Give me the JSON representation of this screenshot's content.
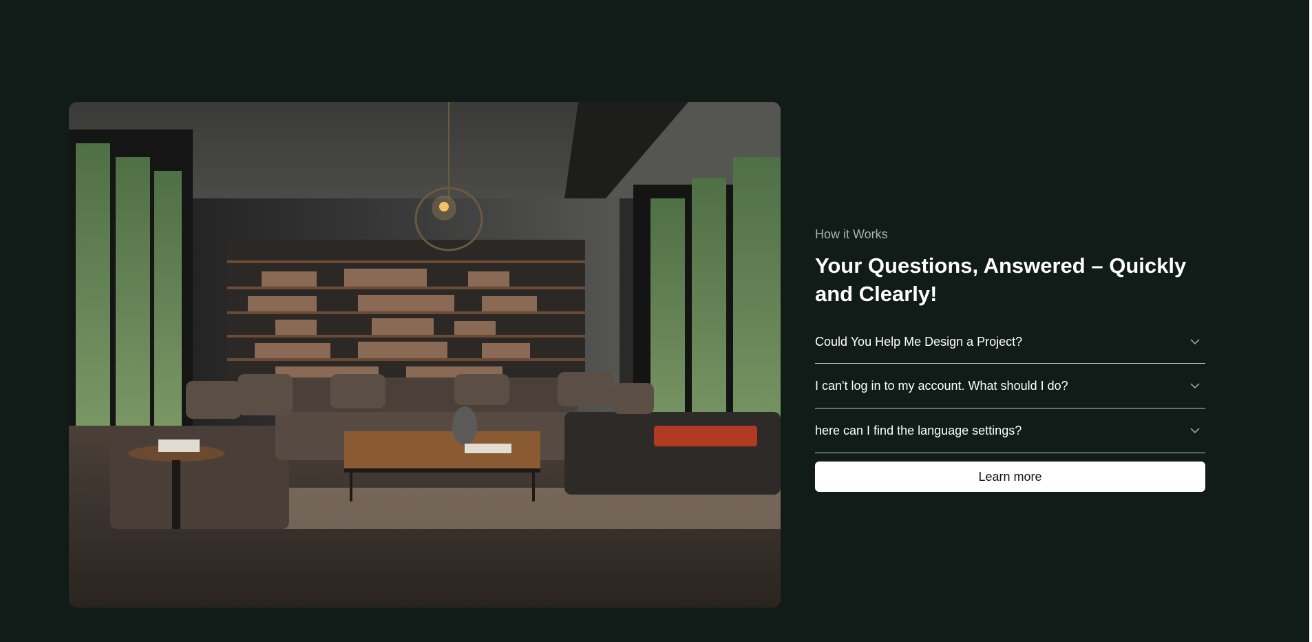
{
  "section": {
    "eyebrow": "How it Works",
    "title": "Your Questions, Answered – Quickly and Clearly!"
  },
  "faq": {
    "items": [
      {
        "question": "Could You Help Me Design a Project?",
        "icon": "chevron-down-icon"
      },
      {
        "question": "I can't log in to my account. What should I do?",
        "icon": "chevron-down-icon"
      },
      {
        "question": "here can I find the language settings?",
        "icon": "chevron-down-icon"
      }
    ],
    "cta_label": "Learn more"
  },
  "colors": {
    "background": "#111b18",
    "text": "#ffffff",
    "muted_text": "#aab3b0",
    "divider": "#c8cccb",
    "button_bg": "#ffffff",
    "button_text": "#111111"
  }
}
